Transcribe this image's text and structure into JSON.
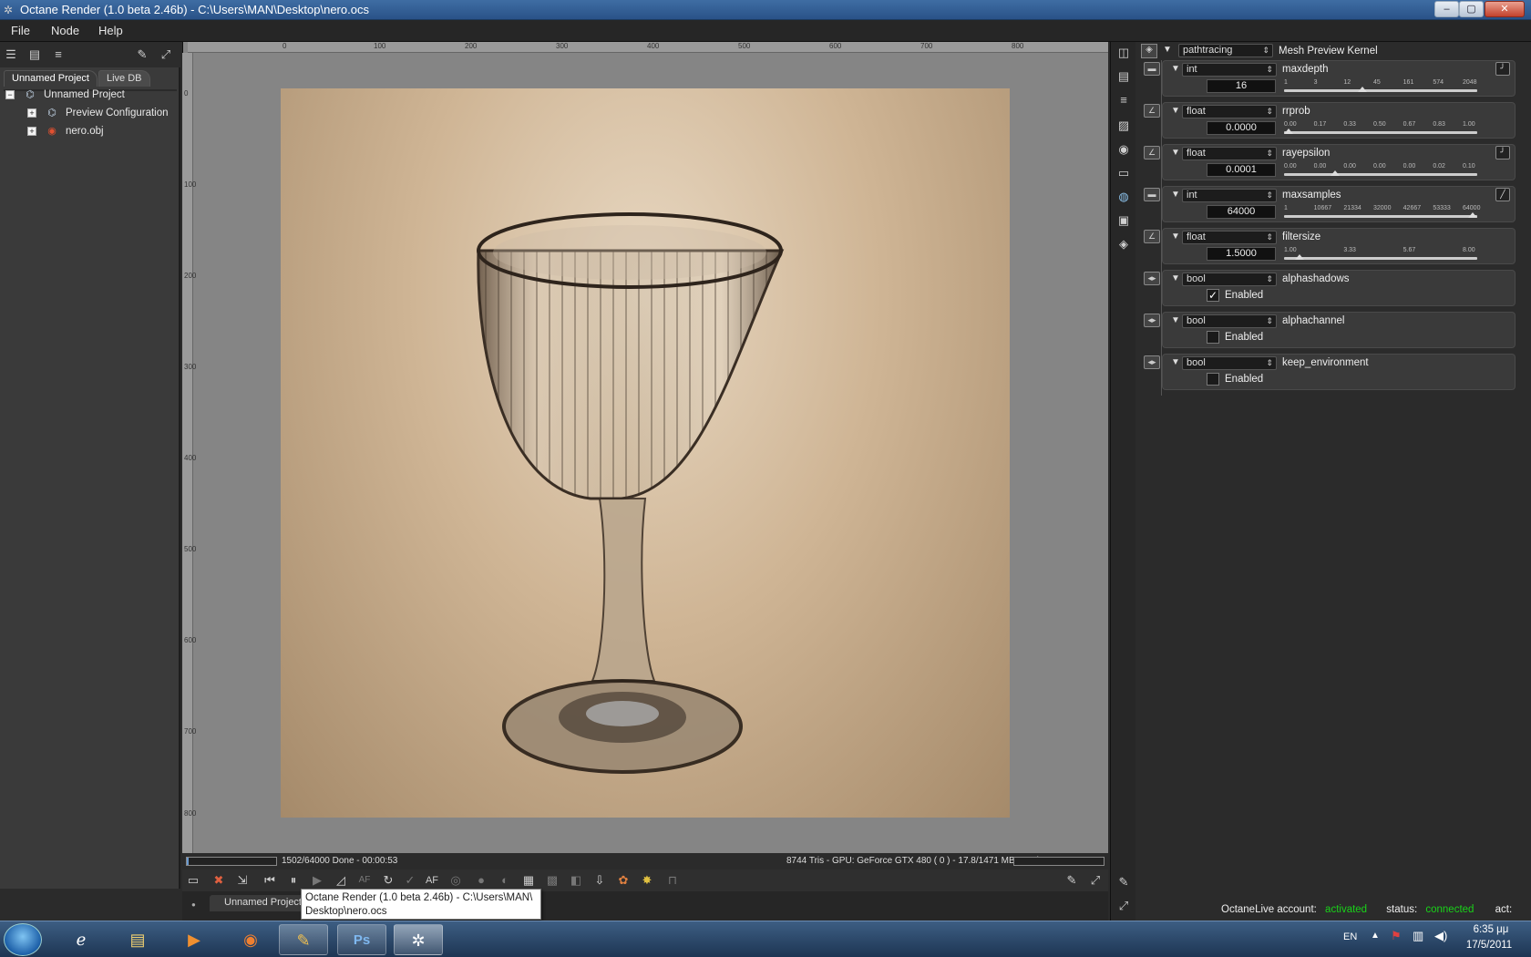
{
  "window": {
    "title": "Octane Render (1.0 beta 2.46b) - C:\\Users\\MAN\\Desktop\\nero.ocs",
    "min": "–",
    "max": "▢",
    "close": "✕"
  },
  "menu": [
    "File",
    "Node",
    "Help"
  ],
  "left": {
    "tabs": [
      "Unnamed Project",
      "Live DB"
    ],
    "tree": [
      {
        "label": "Unnamed Project"
      },
      {
        "label": "Preview Configuration"
      },
      {
        "label": "nero.obj"
      }
    ]
  },
  "ruler": {
    "h": [
      "0",
      "100",
      "200",
      "300",
      "400",
      "500",
      "600",
      "700",
      "800"
    ],
    "v": [
      "0",
      "100",
      "200",
      "300",
      "400",
      "500",
      "600",
      "700",
      "800"
    ]
  },
  "status": {
    "progress": "1502/64000 Done - 00:00:53",
    "gpu": "8744 Tris - GPU: GeForce GTX 480 ( 0 ) - 17.8/1471 MB Used",
    "progress_fraction": 0.0235
  },
  "render_toolbar": {
    "af1": "AF",
    "af2": "AF"
  },
  "bottom": {
    "tab": "Unnamed Project",
    "tooltip_line1": "Octane Render (1.0 beta 2.46b) - C:\\Users\\MAN\\",
    "tooltip_line2": "Desktop\\nero.ocs"
  },
  "kernel": {
    "type": "pathtracing",
    "name": "Mesh Preview Kernel"
  },
  "params": [
    {
      "type": "int",
      "name": "maxdepth",
      "value": "16",
      "ticks": [
        "1",
        "3",
        "12",
        "45",
        "161",
        "574",
        "2048"
      ],
      "pos": 0.4,
      "dot": "#c9a83a"
    },
    {
      "type": "float",
      "name": "rrprob",
      "value": "0.0000",
      "ticks": [
        "0.00",
        "0.17",
        "0.33",
        "0.50",
        "0.67",
        "0.83",
        "1.00"
      ],
      "pos": 0.0,
      "dot": "#8aa0c0"
    },
    {
      "type": "float",
      "name": "rayepsilon",
      "value": "0.0001",
      "ticks": [
        "0.00",
        "0.00",
        "0.00",
        "0.00",
        "0.00",
        "0.02",
        "0.10"
      ],
      "pos": 0.25,
      "dot": "#8aa0c0"
    },
    {
      "type": "int",
      "name": "maxsamples",
      "value": "64000",
      "ticks": [
        "1",
        "10667",
        "21334",
        "32000",
        "42667",
        "53333",
        "64000"
      ],
      "pos": 1.0,
      "dot": "#c9a83a"
    },
    {
      "type": "float",
      "name": "filtersize",
      "value": "1.5000",
      "ticks": [
        "1.00",
        "3.33",
        "5.67",
        "8.00"
      ],
      "pos": 0.06,
      "dot": "#8aa0c0"
    }
  ],
  "bools": [
    {
      "type": "bool",
      "name": "alphashadows",
      "label": "Enabled",
      "checked": "✓"
    },
    {
      "type": "bool",
      "name": "alphachannel",
      "label": "Enabled",
      "checked": ""
    },
    {
      "type": "bool",
      "name": "keep_environment",
      "label": "Enabled",
      "checked": ""
    }
  ],
  "live": {
    "account_label": "OctaneLive account:",
    "account_value": "activated",
    "status_label": "status:",
    "status_value": "connected",
    "act_label": "act:",
    "green": "#19d219"
  },
  "taskbar": {
    "lang": "EN",
    "time": "6:35 μμ",
    "date": "17/5/2011"
  }
}
